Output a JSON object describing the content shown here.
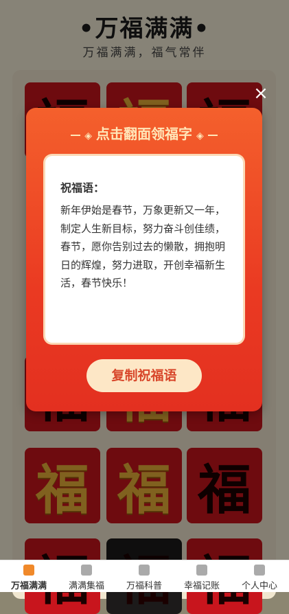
{
  "header": {
    "title": "•万福满满•",
    "subtitle": "万福满满，福气常伴"
  },
  "modal": {
    "title": "点击翻面领福字",
    "blessing_heading": "祝福语：",
    "blessing_text": "新年伊始是春节，万象更新又一年，制定人生新目标，努力奋斗创佳绩，春节，愿你告别过去的懒散，拥抱明日的辉煌，努力进取，开创幸福新生活，春节快乐！",
    "copy_button": "复制祝福语",
    "close_icon": "×"
  },
  "cards": [
    {
      "glyph": "福"
    },
    {
      "glyph": "福"
    },
    {
      "glyph": "福"
    },
    {
      "glyph": "福"
    },
    {
      "glyph": "福"
    },
    {
      "glyph": "福"
    },
    {
      "glyph": "福"
    },
    {
      "glyph": "福"
    },
    {
      "glyph": "福"
    },
    {
      "glyph": "福"
    },
    {
      "glyph": "福"
    },
    {
      "glyph": "福"
    }
  ],
  "tabs": [
    {
      "label": "万福满满",
      "icon": "gift-icon"
    },
    {
      "label": "满满集福",
      "icon": "badge-icon"
    },
    {
      "label": "万福科普",
      "icon": "book-icon"
    },
    {
      "label": "幸福记账",
      "icon": "note-icon"
    },
    {
      "label": "个人中心",
      "icon": "user-icon"
    }
  ],
  "colors": {
    "accent": "#f0892a",
    "modal": "#ea3a22",
    "button": "#fde7c6"
  }
}
